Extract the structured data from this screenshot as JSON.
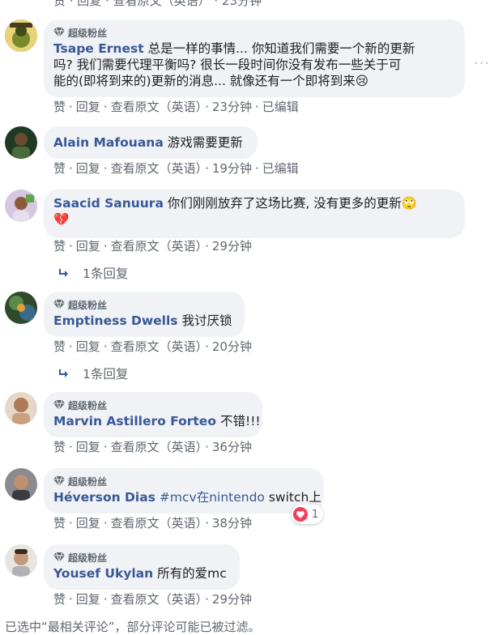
{
  "top_clipped": {
    "text": "赞 · 回复 · 查看原文（英语） · 23分钟"
  },
  "super_fan_label": "超级粉丝",
  "actions": {
    "like": "赞",
    "reply": "回复",
    "translate": "查看原文（英语）",
    "edited": "已编辑"
  },
  "comments": [
    {
      "author": "Tsape Ernest",
      "super_fan": true,
      "text_lines": [
        "总是一样的事情... 你知道我们需要一个新的更新",
        "吗? 我们需要代理平衡吗? 很长一段时间你没有发布一些关于可",
        "能的(即将到来的)更新的消息... 就像还有一个即将到来😢"
      ],
      "time": "23分钟",
      "edited": true,
      "avatar_color": "#8c9a3c"
    },
    {
      "author": "Alain Mafouana",
      "super_fan": false,
      "text_lines": [
        "游戏需要更新"
      ],
      "time": "19分钟",
      "edited": true,
      "avatar_color": "#2f3a2e"
    },
    {
      "author": "Saacid Sanuura",
      "super_fan": false,
      "text_lines": [
        "你们刚刚放弃了这场比赛, 没有更多的更新🙄",
        "💔"
      ],
      "time": "29分钟",
      "edited": false,
      "replies": "1条回复",
      "avatar_color": "#c9b7d6"
    },
    {
      "author": "Emptiness Dwells",
      "super_fan": true,
      "text_lines": [
        "我讨厌锁"
      ],
      "time": "20分钟",
      "edited": false,
      "replies": "1条回复",
      "avatar_color": "#3f6b3a"
    },
    {
      "author": "Marvin Astillero Forteo",
      "super_fan": true,
      "text_lines": [
        "不错!!!"
      ],
      "time": "36分钟",
      "edited": false,
      "avatar_color": "#a0785a"
    },
    {
      "author": "Héverson Dias",
      "super_fan": true,
      "hashtag": "#mcv在nintendo",
      "text_lines": [
        " switch上"
      ],
      "time": "38分钟",
      "edited": false,
      "reaction_count": "1",
      "avatar_color": "#6a6a70"
    },
    {
      "author": "Yousef Ukylan",
      "super_fan": true,
      "text_lines": [
        "所有的爱mc"
      ],
      "time": "29分钟",
      "edited": false,
      "avatar_color": "#b99780"
    }
  ],
  "footer_note": "已选中“最相关评论”，部分评论可能已被过滤。",
  "colors": {
    "bubble": "#f0f2f5",
    "author": "#385898",
    "meta": "#606770",
    "heart": "#f33e58"
  }
}
